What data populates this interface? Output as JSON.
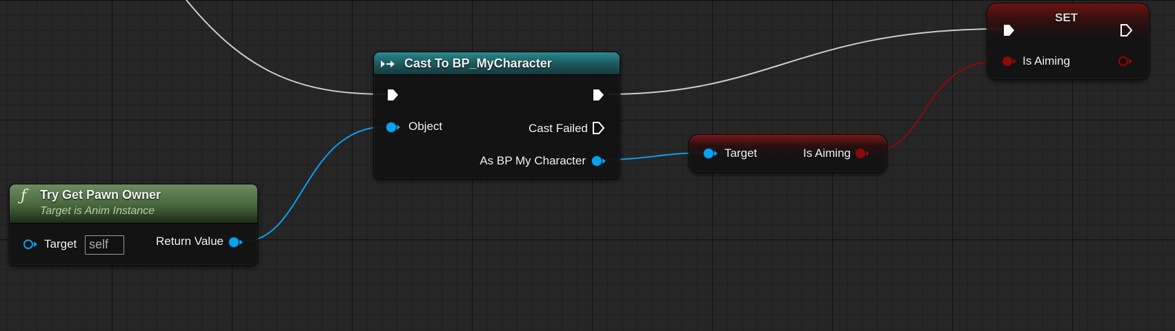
{
  "nodes": {
    "cast": {
      "title": "Cast To BP_MyCharacter",
      "pins": {
        "object": "Object",
        "cast_failed": "Cast Failed",
        "as_character": "As BP My Character"
      }
    },
    "try_get": {
      "title": "Try Get Pawn Owner",
      "subtitle": "Target is Anim Instance",
      "pins": {
        "target": "Target",
        "target_default": "self",
        "return_value": "Return Value"
      }
    },
    "getter": {
      "pins": {
        "target": "Target",
        "is_aiming": "Is Aiming"
      }
    },
    "set": {
      "title": "SET",
      "pins": {
        "is_aiming": "Is Aiming"
      }
    }
  },
  "colors": {
    "object_pin": "#0aa2f0",
    "bool_pin": "#8e0a0a",
    "exec_wire": "#cfcfcf",
    "cast_header": "#1f6f75",
    "function_header": "#5a7a4e",
    "variable_header": "#6a1414"
  },
  "icons": {
    "function": "function-icon",
    "cast": "cast-icon",
    "exec": "exec-pin-icon"
  }
}
